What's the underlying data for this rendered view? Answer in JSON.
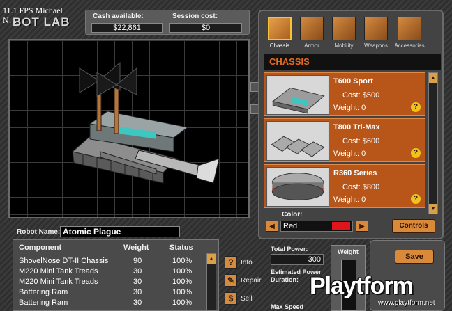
{
  "overlay": {
    "fps_text": "11.1 FPS Michael",
    "fps_text2": "N…",
    "screen_title": "BOT LAB"
  },
  "cash": {
    "available_label": "Cash available:",
    "available_value": "$22,861",
    "session_label": "Session cost:",
    "session_value": "$0"
  },
  "tabs": [
    {
      "label": "Chassis",
      "icon": "chassis-icon",
      "active": true
    },
    {
      "label": "Armor",
      "icon": "armor-icon",
      "active": false
    },
    {
      "label": "Mobility",
      "icon": "mobility-icon",
      "active": false
    },
    {
      "label": "Weapons",
      "icon": "weapons-icon",
      "active": false
    },
    {
      "label": "Accessories",
      "icon": "accessories-icon",
      "active": false
    }
  ],
  "category": {
    "title": "CHASSIS"
  },
  "parts": [
    {
      "name": "T600 Sport",
      "cost": "Cost: $500",
      "weight": "Weight: 0",
      "help": "?"
    },
    {
      "name": "T800 Tri-Max",
      "cost": "Cost: $600",
      "weight": "Weight: 0",
      "help": "?"
    },
    {
      "name": "R360 Series",
      "cost": "Cost: $800",
      "weight": "Weight: 0",
      "help": "?"
    }
  ],
  "color": {
    "label": "Color:",
    "value": "Red",
    "swatch": "#e0141b"
  },
  "buttons": {
    "controls": "Controls",
    "save": "Save",
    "info": "Info",
    "repair": "Repair",
    "sell": "Sell"
  },
  "robot": {
    "name_label": "Robot Name:",
    "name_value": "Atomic Plague"
  },
  "components": {
    "headers": {
      "component": "Component",
      "weight": "Weight",
      "status": "Status"
    },
    "rows": [
      {
        "component": "ShovelNose DT-II Chassis",
        "weight": "90",
        "status": "100%"
      },
      {
        "component": "M220 Mini Tank Treads",
        "weight": "30",
        "status": "100%"
      },
      {
        "component": "M220 Mini Tank Treads",
        "weight": "30",
        "status": "100%"
      },
      {
        "component": "Battering Ram",
        "weight": "30",
        "status": "100%"
      },
      {
        "component": "Battering Ram",
        "weight": "30",
        "status": "100%"
      }
    ]
  },
  "stats": {
    "total_power_label": "Total Power:",
    "total_power_value": "300",
    "power_duration_label": "Estimated Power Duration:",
    "max_speed_label": "Max Speed",
    "weight_label": "Weight"
  },
  "watermark": {
    "brand": "Playtform",
    "url": "www.playtform.net"
  },
  "colors": {
    "accent": "#d88a3a",
    "item_bg": "#b8561a",
    "category_text": "#e56a1f"
  }
}
